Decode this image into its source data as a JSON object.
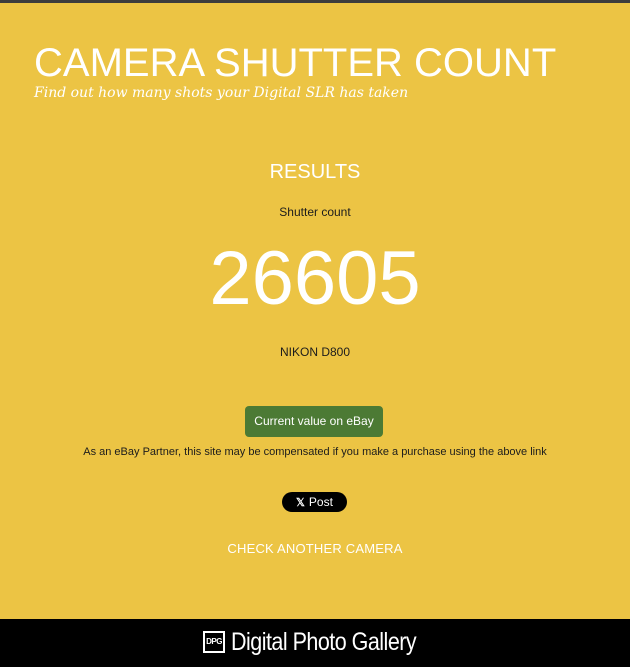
{
  "header": {
    "title": "CAMERA SHUTTER COUNT",
    "tagline": "Find out how many shots your Digital SLR has taken"
  },
  "results": {
    "heading": "RESULTS",
    "count_label": "Shutter count",
    "count_value": "26605",
    "camera_model": "NIKON D800"
  },
  "actions": {
    "ebay_button_label": "Current value on eBay",
    "disclosure": "As an eBay Partner, this site may be compensated if you make a purchase using the above link",
    "x_post_glyph": "𝕏",
    "x_post_label": "Post",
    "check_another_label": "CHECK ANOTHER CAMERA"
  },
  "footer": {
    "logo_mark": "DPG",
    "brand": "Digital Photo Gallery"
  },
  "colors": {
    "background": "#ecc444",
    "button_green": "#4c7a34",
    "footer_black": "#000000",
    "text_white": "#ffffff"
  }
}
